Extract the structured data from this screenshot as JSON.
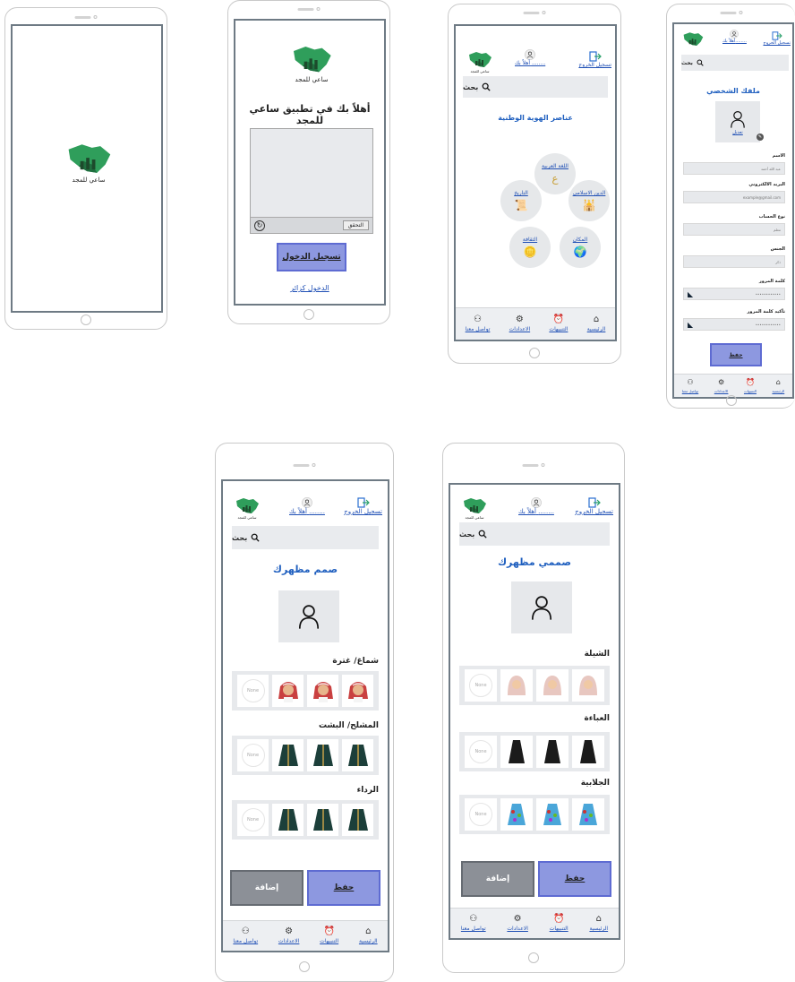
{
  "brand": {
    "name": "ساعي للمجد",
    "primary": "#1f5fbf",
    "button_save": "#8d98e0",
    "button_add": "#8c9097"
  },
  "splash": {
    "logo_text": "ساعي للمجد"
  },
  "welcome": {
    "logo_text": "ساعي للمجد",
    "title": "أهلاً بك في تطبيق ساعي للمجد",
    "captcha_label": "التحقق",
    "login_button": "تسجيل الدخول",
    "guest_link": "الدخول كزائر"
  },
  "header": {
    "logout": "تسجيل الخروج",
    "greeting": "أهلاً بك",
    "greeting_blank": "........",
    "logo_text": "ساعي للمجد",
    "search_placeholder": "بحث"
  },
  "home": {
    "title": "عناصر الهوية الوطنية",
    "items": [
      {
        "label": "اللغة العربية",
        "icon": "letters-icon"
      },
      {
        "label": "الدين الاسلامي",
        "icon": "mosque-icon"
      },
      {
        "label": "المكان",
        "icon": "globe-icon"
      },
      {
        "label": "الثقافة",
        "icon": "coins-icon"
      },
      {
        "label": "التاريخ",
        "icon": "scroll-icon"
      }
    ]
  },
  "profile": {
    "title": "ملفك الشخصي",
    "edit": "تعديل",
    "fields": [
      {
        "label": "الاسم",
        "value": "عبد الله أحمد"
      },
      {
        "label": "البريد الالكتروني",
        "value": "example@gmail.com"
      },
      {
        "label": "نوع الحساب",
        "value": "معلم"
      },
      {
        "label": "الجنس",
        "value": "ذكر"
      },
      {
        "label": "كلمة المرور",
        "value": "••••••••••••"
      },
      {
        "label": "تأكيد كلمة المرور",
        "value": "••••••••••••"
      }
    ],
    "save": "حفظ"
  },
  "design_male": {
    "title": "صمم مظهرك",
    "sections": [
      {
        "label": "شماغ/ غترة",
        "none": "None"
      },
      {
        "label": "المشلح/ البشت",
        "none": "None"
      },
      {
        "label": "الرداء",
        "none": "None"
      }
    ],
    "save": "حفظ",
    "add": "إضافة"
  },
  "design_female": {
    "title": "صممي مظهرك",
    "sections": [
      {
        "label": "الشيلة",
        "none": "None"
      },
      {
        "label": "العباءة",
        "none": "None"
      },
      {
        "label": "الجلابية",
        "none": "None"
      }
    ],
    "save": "حفظ",
    "add": "إضافة"
  },
  "nav": [
    {
      "label": "تواصل معنا",
      "icon": "contact-icon"
    },
    {
      "label": "الاعدادات",
      "icon": "settings-icon"
    },
    {
      "label": "التنبيهات",
      "icon": "bell-icon"
    },
    {
      "label": "الرئيسية",
      "icon": "home-icon"
    }
  ]
}
